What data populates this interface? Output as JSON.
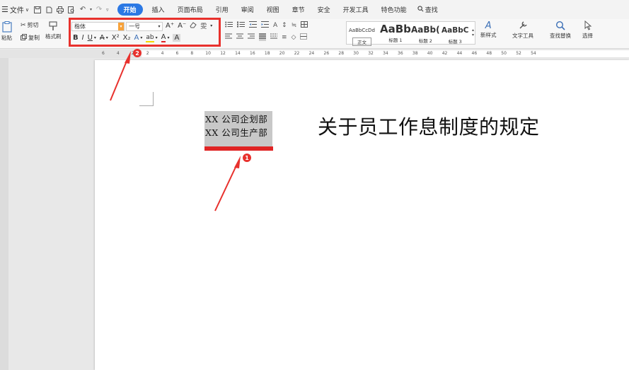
{
  "menubar": {
    "file_label": "文件",
    "tabs": [
      "开始",
      "插入",
      "页面布局",
      "引用",
      "审阅",
      "视图",
      "章节",
      "安全",
      "开发工具",
      "特色功能"
    ],
    "active_tab": "开始",
    "search_label": "查找"
  },
  "ribbon": {
    "paste_label": "粘贴",
    "cut_label": "剪切",
    "copy_label": "复制",
    "format_painter_label": "格式刷",
    "font_name": "楷体",
    "font_size": "一号",
    "bold": "B",
    "italic": "I",
    "underline": "U",
    "strikethrough": "A",
    "superscript": "X²",
    "subscript": "X₂",
    "text_effect": "A",
    "highlight": "ab",
    "font_color": "A",
    "char_shading": "A",
    "grow_font": "A⁺",
    "shrink_font": "A⁻",
    "styles": [
      {
        "preview": "AaBbCcDd",
        "label": "正文"
      },
      {
        "preview": "AaBb",
        "label": "标题 1"
      },
      {
        "preview": "AaBb(",
        "label": "标题 2"
      },
      {
        "preview": "AaBbC",
        "label": "标题 3"
      }
    ],
    "new_style_label": "新样式",
    "text_tools_label": "文字工具",
    "find_replace_label": "查找替换",
    "select_label": "选择"
  },
  "ruler": {
    "numbers": [
      "6",
      "4",
      "2",
      "2",
      "4",
      "6",
      "8",
      "10",
      "12",
      "14",
      "16",
      "18",
      "20",
      "22",
      "24",
      "26",
      "28",
      "30",
      "32",
      "34",
      "36",
      "38",
      "40",
      "42",
      "44",
      "46",
      "48",
      "50",
      "52",
      "54"
    ]
  },
  "document": {
    "dept_lines": [
      "XX 公司企划部",
      "XX 公司生产部"
    ],
    "title": "关于员工作息制度的规定"
  },
  "annotations": {
    "badge_1": "1",
    "badge_2": "2"
  },
  "colors": {
    "accent": "#2b78e4",
    "highlight_red": "#e8312d",
    "selection_gray": "#c8c8c8"
  }
}
